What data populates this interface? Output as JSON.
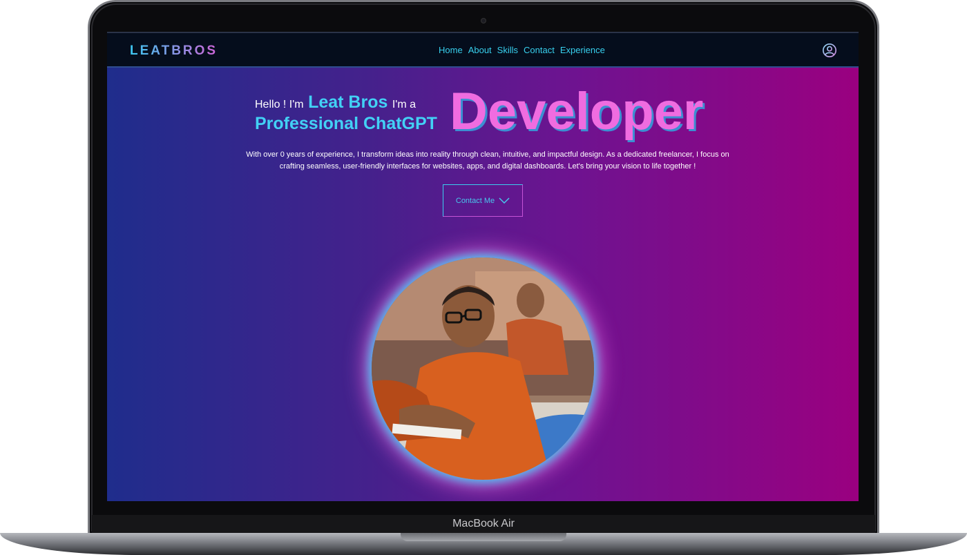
{
  "device": {
    "label": "MacBook Air"
  },
  "nav": {
    "logo": "LEATBROS",
    "items": [
      {
        "label": "Home"
      },
      {
        "label": "About"
      },
      {
        "label": "Skills"
      },
      {
        "label": "Contact"
      },
      {
        "label": "Experience"
      }
    ],
    "user_icon": "user-circle-icon"
  },
  "hero": {
    "greeting_prefix": "Hello ! I'm",
    "name": "Leat Bros",
    "im_a": "I'm a",
    "role_line": "Professional ChatGPT",
    "role_big": "Developer",
    "description": "With over 0 years of experience, I transform ideas into reality through clean, intuitive, and impactful design. As a dedicated freelancer, I focus on crafting seamless, user-friendly interfaces for websites, apps, and digital dashboards. Let's bring your vision to life together !",
    "contact_button": "Contact Me",
    "contact_icon": "chevron-down-icon"
  },
  "colors": {
    "accent_cyan": "#42d1f5",
    "accent_pink": "#f06ce0",
    "gradient_start": "#1f2d8c",
    "gradient_end": "#9a0080",
    "nav_bg": "#050d1c"
  }
}
